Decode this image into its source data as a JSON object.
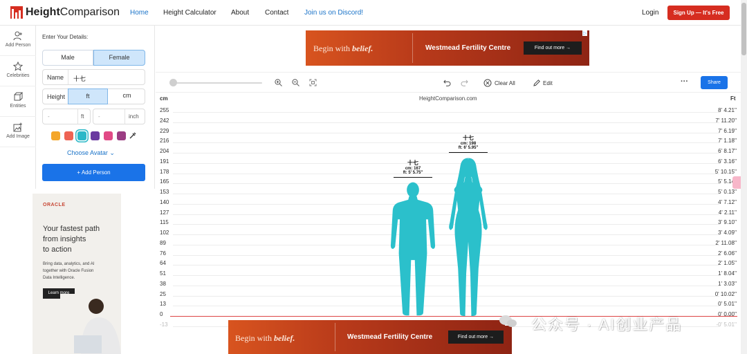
{
  "nav": {
    "logo_bold": "Height",
    "logo_rest": "Comparison",
    "links": [
      "Home",
      "Height Calculator",
      "About",
      "Contact",
      "Join us on Discord!"
    ],
    "login": "Login",
    "signup": "Sign Up — It's Free"
  },
  "rail": [
    {
      "label": "Add Person",
      "icon": "add-person-icon"
    },
    {
      "label": "Celebrities",
      "icon": "star-icon"
    },
    {
      "label": "Entities",
      "icon": "cube-icon"
    },
    {
      "label": "Add Image",
      "icon": "image-icon"
    }
  ],
  "form": {
    "title": "Enter Your Details:",
    "gender_options": [
      "Male",
      "Female"
    ],
    "gender_selected": "Female",
    "name_label": "Name",
    "name_value": "十七",
    "height_label": "Height",
    "unit_options": [
      "ft",
      "cm"
    ],
    "unit_selected": "ft",
    "ft_placeholder": "-",
    "ft_unit": "ft",
    "inch_placeholder": "-",
    "inch_unit": "inch",
    "colors": [
      "#f4a62a",
      "#ee6353",
      "#2bb8c8",
      "#6b3aa0",
      "#e14a86",
      "#9b3d83"
    ],
    "selected_color": "#2bb8c8",
    "choose_avatar": "Choose Avatar",
    "add_button": "+ Add Person"
  },
  "left_ad": {
    "brand": "ORACLE",
    "headline": [
      "Your fastest path",
      "from insights",
      "to action"
    ],
    "body": [
      "Bring data, analytics, and AI",
      "together with Oracle Fusion",
      "Data Intelligence."
    ],
    "cta": "Learn more"
  },
  "banner_ad": {
    "begin_text": "Begin with ",
    "begin_emph": "belief.",
    "brand": "Westmead Fertility Centre",
    "cta": "Find out more →"
  },
  "toolbar": {
    "zoom_slider_value": 0,
    "clear_all": "Clear All",
    "edit": "Edit",
    "more": "···",
    "share": "Share"
  },
  "chart": {
    "left_unit": "cm",
    "right_unit": "Ft",
    "site_label": "HeightComparison.com",
    "ticks_cm": [
      "255",
      "242",
      "229",
      "216",
      "204",
      "191",
      "178",
      "165",
      "153",
      "140",
      "127",
      "115",
      "102",
      "89",
      "76",
      "64",
      "51",
      "38",
      "25",
      "13",
      "0",
      "-13"
    ],
    "ticks_ft": [
      "8' 4.21''",
      "7' 11.20''",
      "7' 6.19''",
      "7' 1.18''",
      "6' 8.17''",
      "6' 3.16''",
      "5' 10.15''",
      "5' 5.14''",
      "5' 0.13''",
      "4' 7.12''",
      "4' 2.11''",
      "3' 9.10''",
      "3' 4.09''",
      "2' 11.08''",
      "2' 6.06''",
      "2' 1.05''",
      "1' 8.04''",
      "1' 3.03''",
      "0' 10.02''",
      "0' 5.01''",
      "0' 0.00''",
      "-0' 5.01''"
    ],
    "people": [
      {
        "name": "十七",
        "cm_line": "cm: 167",
        "ft_line": "ft: 5' 5.75''",
        "gender": "male",
        "height_cm": 167,
        "color": "#2bc0cb"
      },
      {
        "name": "十七",
        "cm_line": "cm: 198",
        "ft_line": "ft: 6' 5.95''",
        "gender": "female",
        "height_cm": 198,
        "color": "#2bc0cb"
      }
    ]
  },
  "watermark": "公众号 · AI创业产品"
}
